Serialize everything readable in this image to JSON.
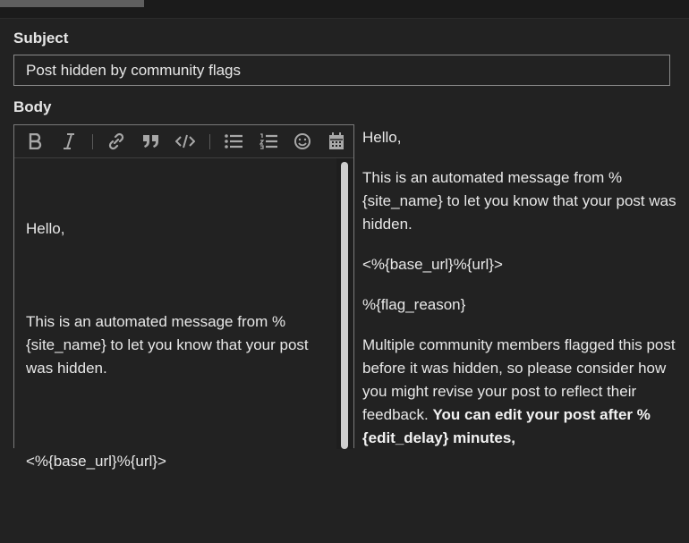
{
  "subject": {
    "label": "Subject",
    "value": "Post hidden by community flags"
  },
  "body": {
    "label": "Body",
    "toolbar": {
      "icons": [
        "bold-icon",
        "italic-icon",
        "link-icon",
        "quote-icon",
        "code-icon",
        "bullet-list-icon",
        "numbered-list-icon",
        "emoji-icon",
        "calendar-icon"
      ]
    },
    "editor_paragraphs": [
      "Hello,",
      "This is an automated message from %{site_name} to let you know that your post was hidden.",
      "<%{base_url}%{url}>"
    ]
  },
  "preview": {
    "p1": "Hello,",
    "p2": "This is an automated message from %{site_name} to let you know that your post was hidden.",
    "p3": "<%{base_url}%{url}>",
    "p4": "%{flag_reason}",
    "p5_normal": "Multiple community members flagged this post before it was hidden, so please consider how you might revise your post to reflect their feedback.",
    "p5_bold": "You can edit your post after %{edit_delay} minutes,"
  }
}
